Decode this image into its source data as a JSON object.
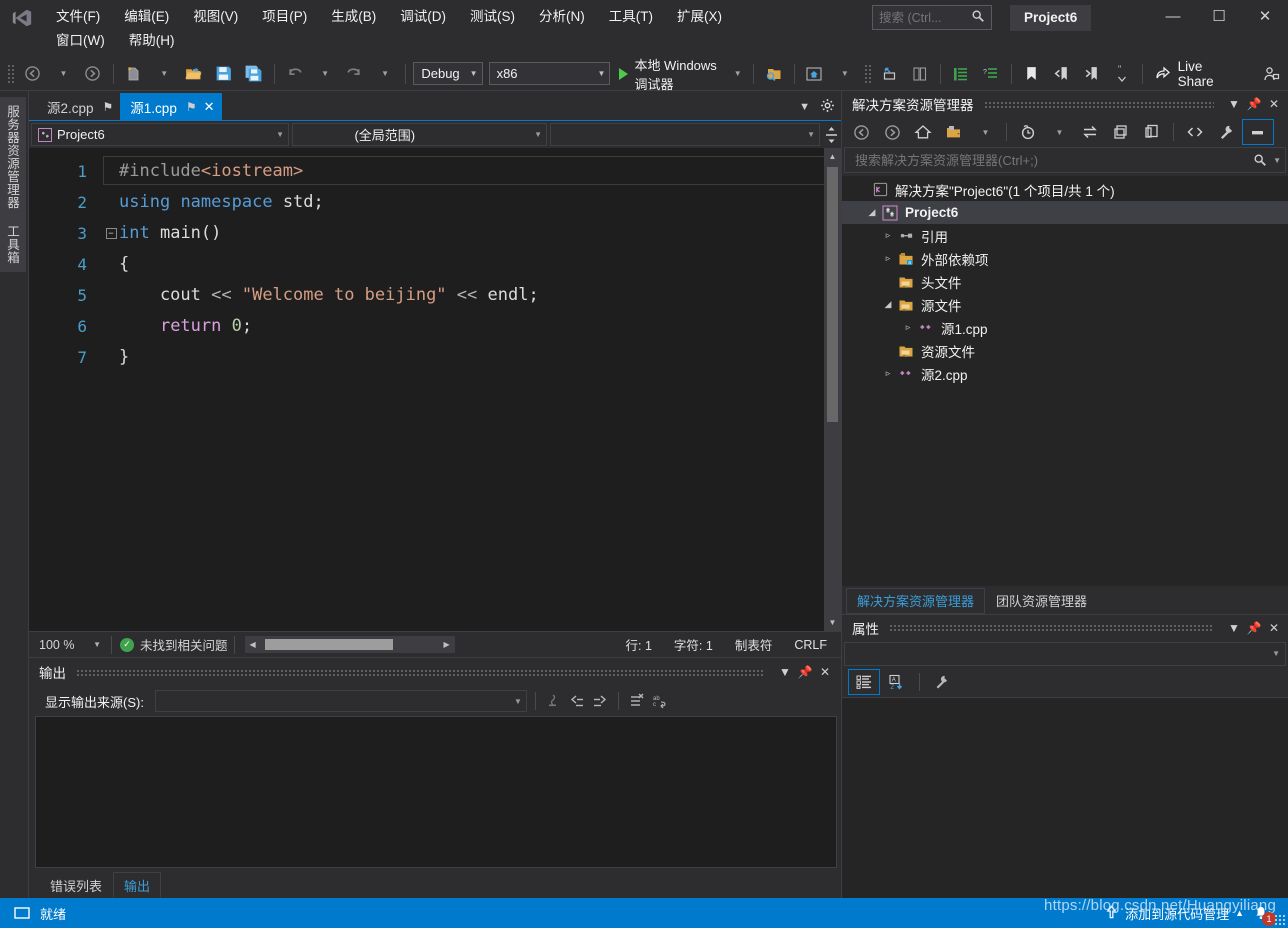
{
  "window": {
    "project_title": "Project6",
    "minimize": "—",
    "maximize": "☐",
    "close": "✕"
  },
  "menubar": {
    "items": [
      {
        "label": "文件(F)"
      },
      {
        "label": "编辑(E)"
      },
      {
        "label": "视图(V)"
      },
      {
        "label": "项目(P)"
      },
      {
        "label": "生成(B)"
      },
      {
        "label": "调试(D)"
      },
      {
        "label": "测试(S)"
      },
      {
        "label": "分析(N)"
      },
      {
        "label": "工具(T)"
      },
      {
        "label": "扩展(X)"
      },
      {
        "label": "窗口(W)"
      },
      {
        "label": "帮助(H)"
      }
    ]
  },
  "search": {
    "placeholder": "搜索 (Ctrl...",
    "value": ""
  },
  "toolbar": {
    "back_tip": "后退",
    "forward_tip": "前进",
    "new_tip": "新建项目",
    "open_tip": "打开文件",
    "save_tip": "保存",
    "saveall_tip": "全部保存",
    "undo_tip": "撤消",
    "redo_tip": "恢复",
    "configuration": "Debug",
    "platform": "x86",
    "run_label": "本地 Windows 调试器",
    "live_share": "Live Share"
  },
  "editor_tabs": [
    {
      "label": "源2.cpp",
      "active": false,
      "pin": "⚑",
      "closable": false
    },
    {
      "label": "源1.cpp",
      "active": true,
      "pin": "⚑",
      "closable": true
    }
  ],
  "navbar": {
    "project": "Project6",
    "scope": "(全局范围)",
    "member": ""
  },
  "code": {
    "lines": [
      {
        "num": "1",
        "tokens": [
          {
            "t": "#include",
            "c": "k-pre"
          },
          {
            "t": "<iostream>",
            "c": "k-inc"
          }
        ]
      },
      {
        "num": "2",
        "tokens": [
          {
            "t": "using",
            "c": "k-kw"
          },
          {
            "t": " ",
            "c": "k-op"
          },
          {
            "t": "namespace",
            "c": "k-kw"
          },
          {
            "t": " ",
            "c": "k-op"
          },
          {
            "t": "std",
            "c": "k-id"
          },
          {
            "t": ";",
            "c": "k-punc"
          }
        ]
      },
      {
        "num": "3",
        "tokens": [
          {
            "t": "int",
            "c": "k-type"
          },
          {
            "t": " ",
            "c": "k-op"
          },
          {
            "t": "main",
            "c": "k-id"
          },
          {
            "t": "()",
            "c": "k-punc"
          }
        ]
      },
      {
        "num": "4",
        "tokens": [
          {
            "t": "{",
            "c": "k-punc"
          }
        ]
      },
      {
        "num": "5",
        "tokens": [
          {
            "t": "    cout",
            "c": "k-id"
          },
          {
            "t": " << ",
            "c": "k-op"
          },
          {
            "t": "\"Welcome to beijing\"",
            "c": "k-str"
          },
          {
            "t": " << ",
            "c": "k-op"
          },
          {
            "t": "endl",
            "c": "k-id"
          },
          {
            "t": ";",
            "c": "k-punc"
          }
        ]
      },
      {
        "num": "6",
        "tokens": [
          {
            "t": "    ",
            "c": "k-op"
          },
          {
            "t": "return",
            "c": "k-ret"
          },
          {
            "t": " ",
            "c": "k-op"
          },
          {
            "t": "0",
            "c": "k-num"
          },
          {
            "t": ";",
            "c": "k-punc"
          }
        ]
      },
      {
        "num": "7",
        "tokens": [
          {
            "t": "}",
            "c": "k-punc"
          }
        ]
      }
    ],
    "plain": "#include<iostream>\nusing namespace std;\nint main()\n{\n    cout << \"Welcome to beijing\" << endl;\n    return 0;\n}"
  },
  "editor_status": {
    "zoom": "100 %",
    "issues": "未找到相关问题",
    "line": "行: 1",
    "char": "字符: 1",
    "tabs": "制表符",
    "eol": "CRLF"
  },
  "output_pane": {
    "title": "输出",
    "source_label": "显示输出来源(S):",
    "source_value": "",
    "content": ""
  },
  "bottom_tabs": [
    {
      "label": "错误列表",
      "active": false
    },
    {
      "label": "输出",
      "active": true
    }
  ],
  "left_dock": {
    "tabs": [
      {
        "label": "服务器资源管理器"
      },
      {
        "label": "工具箱"
      }
    ]
  },
  "solution_explorer": {
    "title": "解决方案资源管理器",
    "search_placeholder": "搜索解决方案资源管理器(Ctrl+;)",
    "search_value": "",
    "tree": [
      {
        "label": "解决方案\"Project6\"(1 个项目/共 1 个)",
        "indent": 0,
        "expander": "",
        "icon": "solution-icon",
        "bold": false,
        "selected": false
      },
      {
        "label": "Project6",
        "indent": 1,
        "expander": "◢",
        "icon": "project-cpp-icon",
        "bold": true,
        "selected": true
      },
      {
        "label": "引用",
        "indent": 2,
        "expander": "▹",
        "icon": "references-icon",
        "bold": false,
        "selected": false
      },
      {
        "label": "外部依赖项",
        "indent": 2,
        "expander": "▹",
        "icon": "ext-dep-icon",
        "bold": false,
        "selected": false
      },
      {
        "label": "头文件",
        "indent": 2,
        "expander": "",
        "icon": "folder-icon",
        "bold": false,
        "selected": false
      },
      {
        "label": "源文件",
        "indent": 2,
        "expander": "◢",
        "icon": "folder-icon",
        "bold": false,
        "selected": false
      },
      {
        "label": "源1.cpp",
        "indent": 3,
        "expander": "▹",
        "icon": "cpp-file-icon",
        "bold": false,
        "selected": false
      },
      {
        "label": "资源文件",
        "indent": 2,
        "expander": "",
        "icon": "folder-icon",
        "bold": false,
        "selected": false
      },
      {
        "label": "源2.cpp",
        "indent": 2,
        "expander": "▹",
        "icon": "cpp-file-icon",
        "bold": false,
        "selected": false
      }
    ],
    "tabs": [
      {
        "label": "解决方案资源管理器",
        "active": true
      },
      {
        "label": "团队资源管理器",
        "active": false
      }
    ]
  },
  "properties_pane": {
    "title": "属性",
    "selected": ""
  },
  "statusbar": {
    "ready": "就绪",
    "source_control": "添加到源代码管理",
    "notification_count": "1",
    "watermark": "https://blog.csdn.net/Huangyiliang"
  },
  "colors": {
    "accent": "#007acc",
    "window_bg": "#2d2d30",
    "editor_bg": "#1e1e1e",
    "tree_bg": "#252526",
    "run_green": "#4ec94e",
    "string": "#d69d85",
    "keyword": "#569cd6",
    "linenum": "#4a9fc9"
  }
}
